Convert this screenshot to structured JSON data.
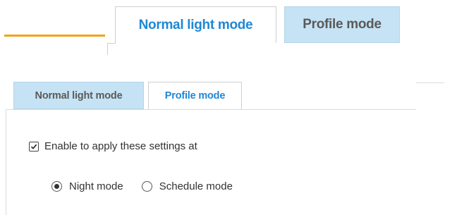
{
  "zoomed_tabs": {
    "active": "Normal light mode",
    "inactive": "Profile mode"
  },
  "tabs": {
    "inactive": "Normal light mode",
    "active": "Profile mode"
  },
  "settings": {
    "enable_label": "Enable to apply these settings at",
    "enable_checked": true,
    "mode_options": [
      {
        "label": "Night mode",
        "selected": true
      },
      {
        "label": "Schedule mode",
        "selected": false
      }
    ]
  },
  "colors": {
    "accent": "#f0a418",
    "active_tab_text": "#1e88d4",
    "inactive_tab_bg": "#c5e3f4"
  }
}
